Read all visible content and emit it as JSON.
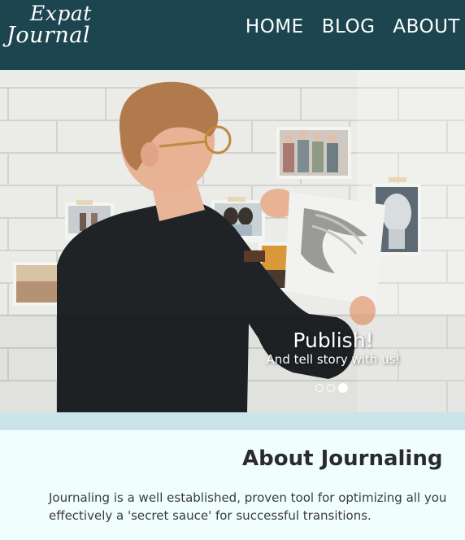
{
  "header": {
    "logo_line1": "Expat",
    "logo_line2": "Journal",
    "nav": [
      "HOME",
      "BLOG",
      "ABOUT"
    ]
  },
  "hero": {
    "title": "Publish!",
    "subtitle": "And tell story with us!",
    "slide_count": 3,
    "active_slide": 3
  },
  "about": {
    "title": "About Journaling",
    "paragraph": "Journaling is a well established, proven tool for optimizing all you\neffectively a 'secret sauce' for successful transitions."
  },
  "colors": {
    "header_bg": "#1d4550",
    "band": "#cbe4e9",
    "page_bg": "#f0fffe"
  }
}
